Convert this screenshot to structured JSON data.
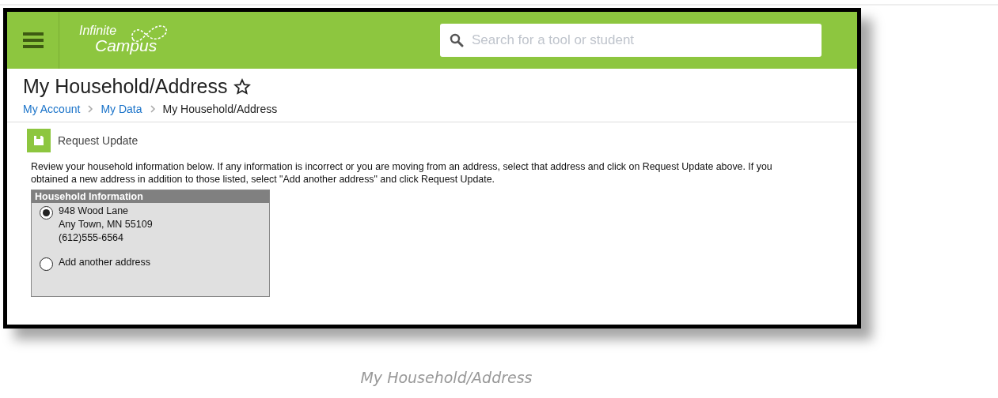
{
  "header": {
    "logo": {
      "line1": "Infinite",
      "line2": "Campus"
    },
    "search": {
      "placeholder": "Search for a tool or student"
    }
  },
  "page": {
    "title": "My Household/Address",
    "breadcrumbs": [
      {
        "label": "My Account",
        "kind": "link"
      },
      {
        "label": "My Data",
        "kind": "link"
      },
      {
        "label": "My Household/Address",
        "kind": "current"
      }
    ]
  },
  "toolbar": {
    "button": "Request Update"
  },
  "instructions": "Review your household information below. If any information is incorrect or you are moving from an address, select that address and click on Request Update above. If you obtained a new address in addition to those listed, select \"Add another address\" and click Request Update.",
  "household": {
    "heading": "Household Information",
    "options": [
      {
        "lines": [
          "948 Wood Lane",
          "Any Town, MN 55109",
          "(612)555-6564"
        ],
        "selected": true
      },
      {
        "lines": [
          "Add another address"
        ],
        "selected": false
      }
    ]
  },
  "caption": "My Household/Address"
}
